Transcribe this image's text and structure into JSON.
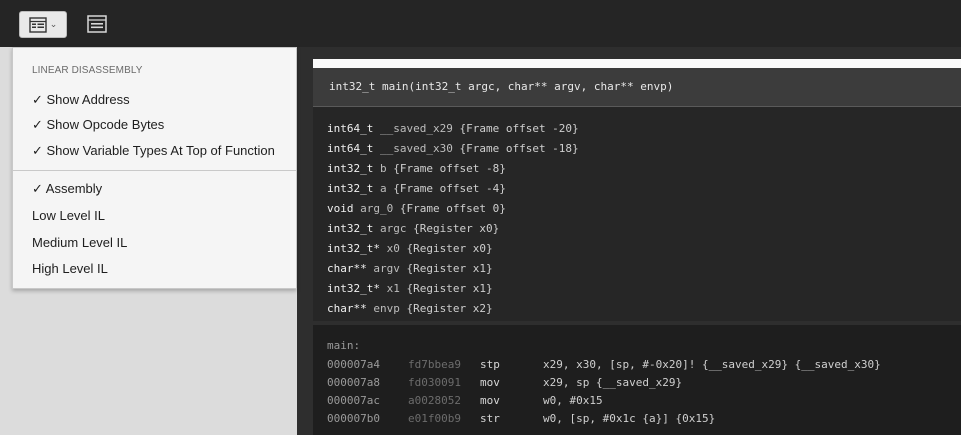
{
  "toolbar": {
    "view_button_icon": "linear-view-icon",
    "view_button_chevron": "⌄",
    "second_button_icon": "window-icon"
  },
  "menu": {
    "header": "LINEAR DISASSEMBLY",
    "options": [
      {
        "label": "✓ Show Address"
      },
      {
        "label": "✓ Show Opcode Bytes"
      },
      {
        "label": "✓ Show Variable Types At Top of Function"
      }
    ],
    "views": [
      {
        "label": "✓ Assembly"
      },
      {
        "label": "Low Level IL"
      },
      {
        "label": "Medium Level IL"
      },
      {
        "label": "High Level IL"
      }
    ]
  },
  "function": {
    "signature": "int32_t main(int32_t argc, char** argv, char** envp)",
    "variables": [
      {
        "type": "int64_t",
        "name": "__saved_x29",
        "info": "{Frame offset -20}"
      },
      {
        "type": "int64_t",
        "name": "__saved_x30",
        "info": "{Frame offset -18}"
      },
      {
        "type": "int32_t",
        "name": "b",
        "info": "{Frame offset -8}"
      },
      {
        "type": "int32_t",
        "name": "a",
        "info": "{Frame offset -4}"
      },
      {
        "type": "void",
        "name": "arg_0",
        "info": "{Frame offset 0}"
      },
      {
        "type": "int32_t",
        "name": "argc",
        "info": "{Register x0}"
      },
      {
        "type": "int32_t*",
        "name": "x0",
        "info": "{Register x0}"
      },
      {
        "type": "char**",
        "name": "argv",
        "info": "{Register x1}"
      },
      {
        "type": "int32_t*",
        "name": "x1",
        "info": "{Register x1}"
      },
      {
        "type": "char**",
        "name": "envp",
        "info": "{Register x2}"
      }
    ]
  },
  "disassembly": {
    "label": "main:",
    "lines": [
      {
        "addr": "000007a4",
        "bytes": "fd7bbea9",
        "mnemonic": "stp",
        "operands": "x29, x30, [sp, #-0x20]! {__saved_x29} {__saved_x30}"
      },
      {
        "addr": "000007a8",
        "bytes": "fd030091",
        "mnemonic": "mov",
        "operands": "x29, sp {__saved_x29}"
      },
      {
        "addr": "000007ac",
        "bytes": "a0028052",
        "mnemonic": "mov",
        "operands": "w0, #0x15"
      },
      {
        "addr": "000007b0",
        "bytes": "e01f00b9",
        "mnemonic": "str",
        "operands": "w0, [sp, #0x1c {a}]  {0x15}"
      }
    ]
  }
}
